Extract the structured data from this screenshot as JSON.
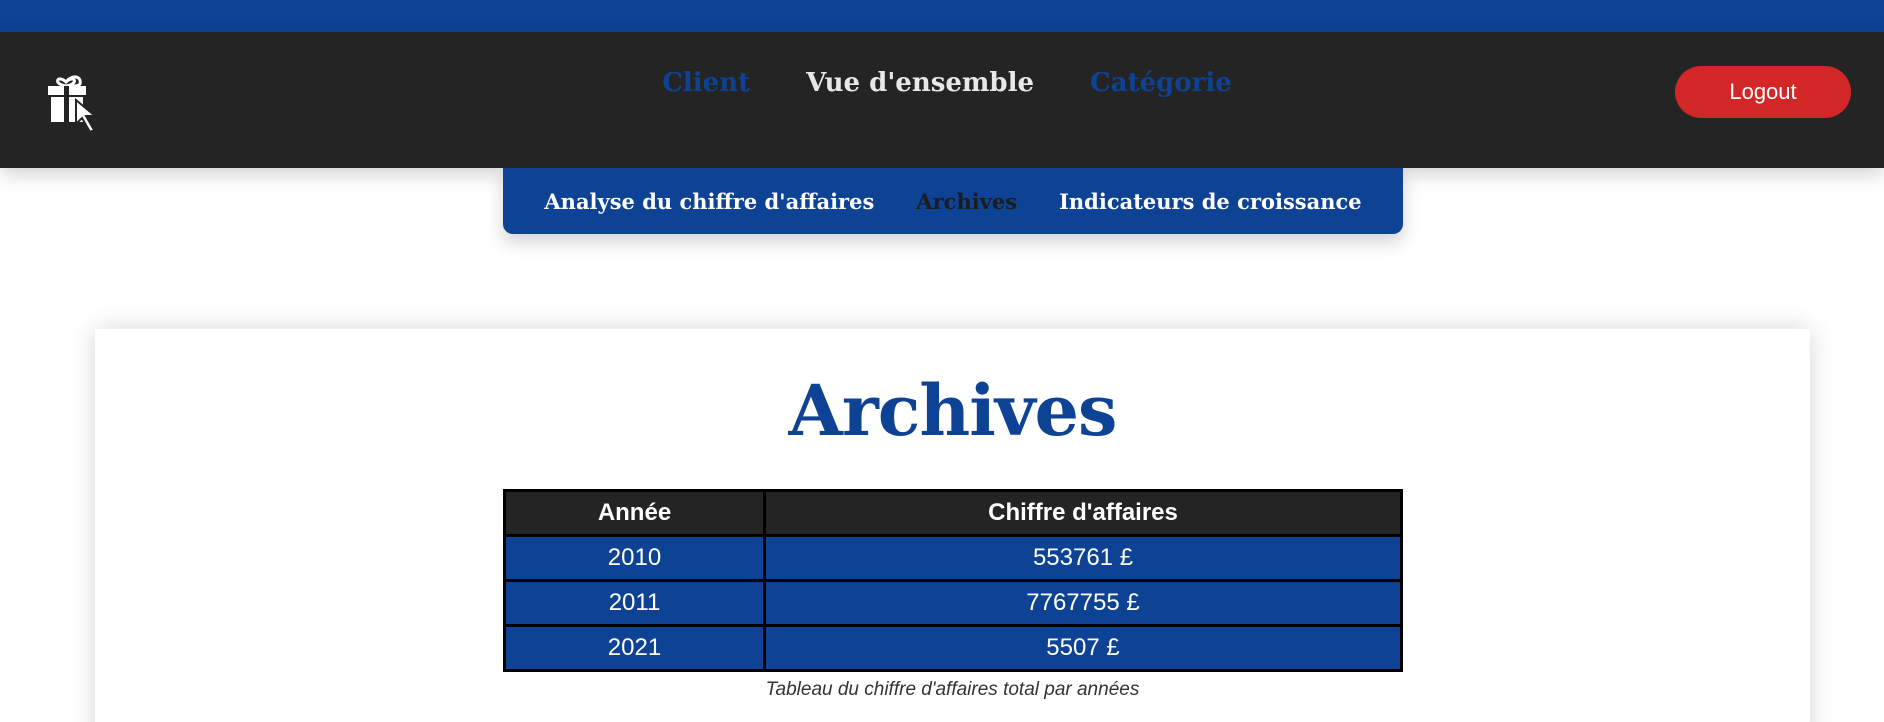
{
  "nav": {
    "items": [
      {
        "label": "Client"
      },
      {
        "label": "Vue d'ensemble"
      },
      {
        "label": "Catégorie"
      }
    ],
    "logout_label": "Logout"
  },
  "subnav": {
    "items": [
      {
        "label": "Analyse du chiffre d'affaires"
      },
      {
        "label": "Archives"
      },
      {
        "label": "Indicateurs de croissance"
      }
    ]
  },
  "page": {
    "title": "Archives",
    "table": {
      "headers": [
        "Année",
        "Chiffre d'affaires"
      ],
      "rows": [
        [
          "2010",
          "553761 £"
        ],
        [
          "2011",
          "7767755 £"
        ],
        [
          "2021",
          "5507 £"
        ]
      ]
    },
    "caption": "Tableau du chiffre d'affaires total par années"
  },
  "colors": {
    "brand_blue": "#0d4294",
    "navbar_dark": "#242424",
    "logout_red": "#d32626"
  },
  "icons": {
    "logo": "gift-cursor-icon"
  }
}
